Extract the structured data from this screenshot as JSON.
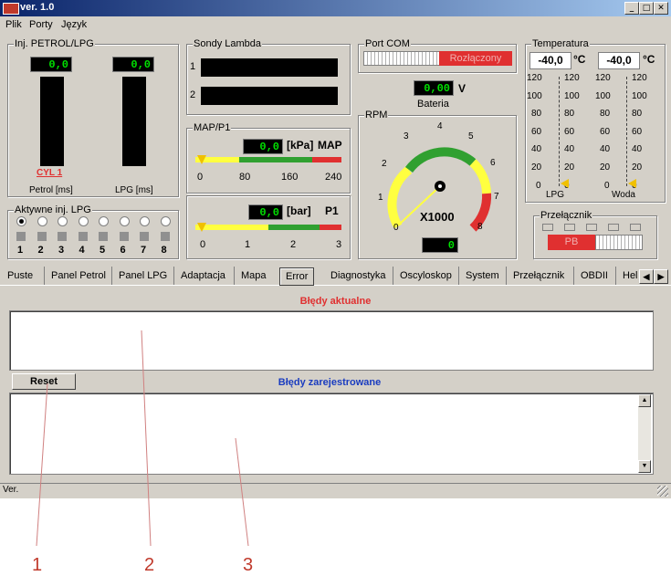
{
  "window": {
    "title": "ver. 1.0",
    "min": "_",
    "max": "□",
    "close": "✕"
  },
  "menu": [
    "Plik",
    "Porty",
    "Język"
  ],
  "petrol_lpg": {
    "group_label": "Inj. PETROL/LPG",
    "petrol_value": "0,0",
    "lpg_value": "0,0",
    "cyl_label": "CYL 1",
    "petrol_label": "Petrol [ms]",
    "lpg_label": "LPG [ms]"
  },
  "active_inj": {
    "group_label": "Aktywne inj. LPG",
    "numbers": [
      "1",
      "2",
      "3",
      "4",
      "5",
      "6",
      "7",
      "8"
    ]
  },
  "lambda": {
    "group_label": "Sondy Lambda",
    "row1": "1",
    "row2": "2"
  },
  "map": {
    "group_label": "MAP/P1",
    "value": "0,0",
    "unit": "[kPa]",
    "name": "MAP",
    "ticks": [
      "0",
      "80",
      "160",
      "240"
    ],
    "p1_value": "0,0",
    "p1_unit": "[bar]",
    "p1_name": "P1",
    "p1_ticks": [
      "0",
      "1",
      "2",
      "3"
    ]
  },
  "port_com": {
    "group_label": "Port COM",
    "status": "Rozłączony"
  },
  "battery": {
    "value": "0,00",
    "unit": "V",
    "label": "Bateria"
  },
  "rpm": {
    "group_label": "RPM",
    "ticks": [
      "0",
      "1",
      "2",
      "3",
      "4",
      "5",
      "6",
      "7",
      "8"
    ],
    "multiplier": "X1000",
    "value": "0"
  },
  "temperature": {
    "group_label": "Temperatura",
    "lpg_value": "-40,0",
    "water_value": "-40,0",
    "unit": "°C",
    "scale": [
      "120",
      "100",
      "80",
      "60",
      "40",
      "20",
      "0"
    ],
    "lpg_label": "LPG",
    "water_label": "Woda"
  },
  "switch": {
    "group_label": "Przełącznik",
    "mode": "PB"
  },
  "tabs": [
    "Puste",
    "Panel Petrol",
    "Panel LPG",
    "Adaptacja",
    "Mapa",
    "Error",
    "Diagnostyka",
    "Oscyloskop",
    "System",
    "Przełącznik",
    "OBDII",
    "Hel"
  ],
  "errors": {
    "current_title": "Błędy aktualne",
    "registered_title": "Błędy zarejestrowane",
    "reset_label": "Reset"
  },
  "status_bar": {
    "text": "Ver."
  },
  "callouts": [
    "1",
    "2",
    "3"
  ],
  "colors": {
    "accent_red": "#e03030",
    "title_blue": "#1a3cc0",
    "lcd_green": "#00e000"
  }
}
